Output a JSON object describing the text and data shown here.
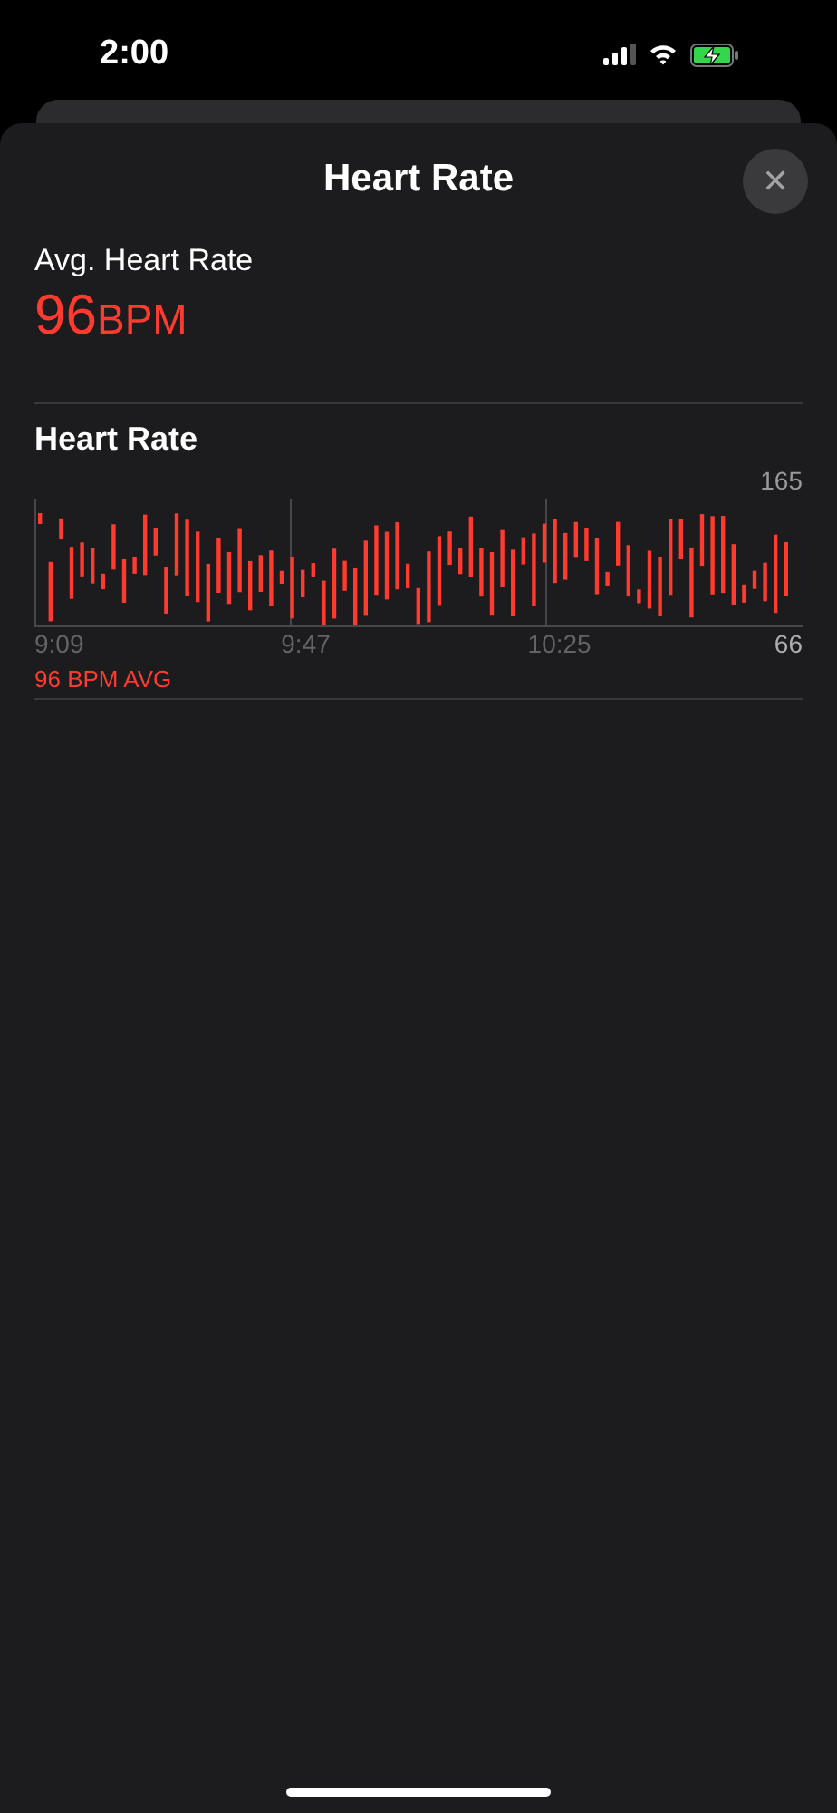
{
  "status_bar": {
    "time": "2:00",
    "charging": true
  },
  "sheet": {
    "title": "Heart Rate",
    "close_icon": "✕"
  },
  "summary": {
    "label": "Avg. Heart Rate",
    "value": "96",
    "unit": "BPM"
  },
  "chart_section": {
    "title": "Heart Rate",
    "max_label": "165",
    "min_label": "66",
    "time_labels": [
      "9:09",
      "9:47",
      "10:25"
    ],
    "average": "96 BPM AVG"
  }
}
